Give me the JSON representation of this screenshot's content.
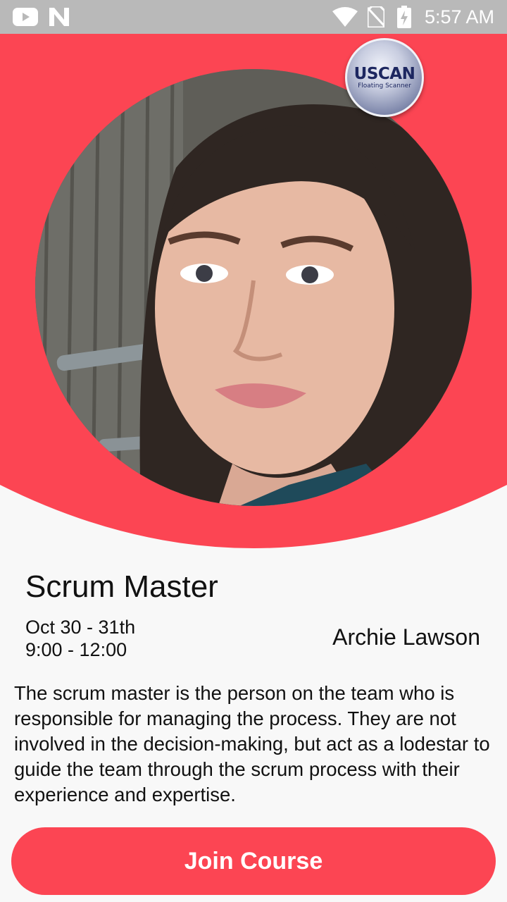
{
  "status_bar": {
    "time": "5:57 AM",
    "left_icons": [
      "youtube-icon",
      "n-app-icon"
    ],
    "right_icons": [
      "wifi-icon",
      "no-sim-icon",
      "battery-charging-icon"
    ]
  },
  "badge": {
    "title": "USCAN",
    "subtitle": "Floating Scanner"
  },
  "course": {
    "title": "Scrum Master",
    "date_line1": "Oct 30 - 31th",
    "date_line2": "9:00 - 12:00",
    "instructor": "Archie Lawson",
    "description": "The scrum master is the person on the team who is responsible for managing the process. They are not involved in the decision-making, but act as a lodestar to guide the team through the scrum process with their experience and expertise."
  },
  "actions": {
    "join_label": "Join Course"
  },
  "colors": {
    "accent": "#fc4553",
    "status_bar": "#b9b9b9",
    "background": "#f8f8f8"
  }
}
